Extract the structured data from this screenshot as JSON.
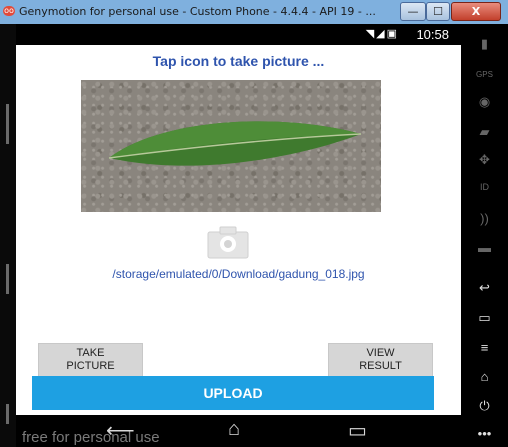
{
  "window": {
    "title": "Genymotion for personal use - Custom Phone - 4.4.4 - API 19 - ...",
    "app_icon": "genymotion-icon",
    "minimize_glyph": "—",
    "maximize_glyph": "☐",
    "close_glyph": "X"
  },
  "statusbar": {
    "icons": "◥◢▣",
    "time": "10:58"
  },
  "screen": {
    "heading": "Tap icon to take picture ...",
    "file_path": "/storage/emulated/0/Download/gadung_018.jpg",
    "take_picture_label": "TAKE\nPICTURE",
    "view_result_label": "VIEW\nRESULT",
    "upload_label": "UPLOAD"
  },
  "navbar": {
    "watermark": "free for personal use",
    "back_glyph": "⟵",
    "home_glyph": "⌂",
    "recents_glyph": "▭"
  },
  "sidepanel": {
    "battery_glyph": "▮",
    "gps_label": "GPS",
    "camera_glyph": "◉",
    "clapper_glyph": "▰",
    "dpad_glyph": "✥",
    "id_label": "ID",
    "rss_glyph": "))",
    "sms_glyph": "▬",
    "back_glyph": "↩",
    "menu_glyph": "▭",
    "menu2_glyph": "≡",
    "home_glyph": "⌂",
    "power_glyph": "⏻",
    "more_glyph": "•••"
  },
  "colors": {
    "accent_blue": "#2f54ad",
    "upload_blue": "#1ea0e2"
  }
}
